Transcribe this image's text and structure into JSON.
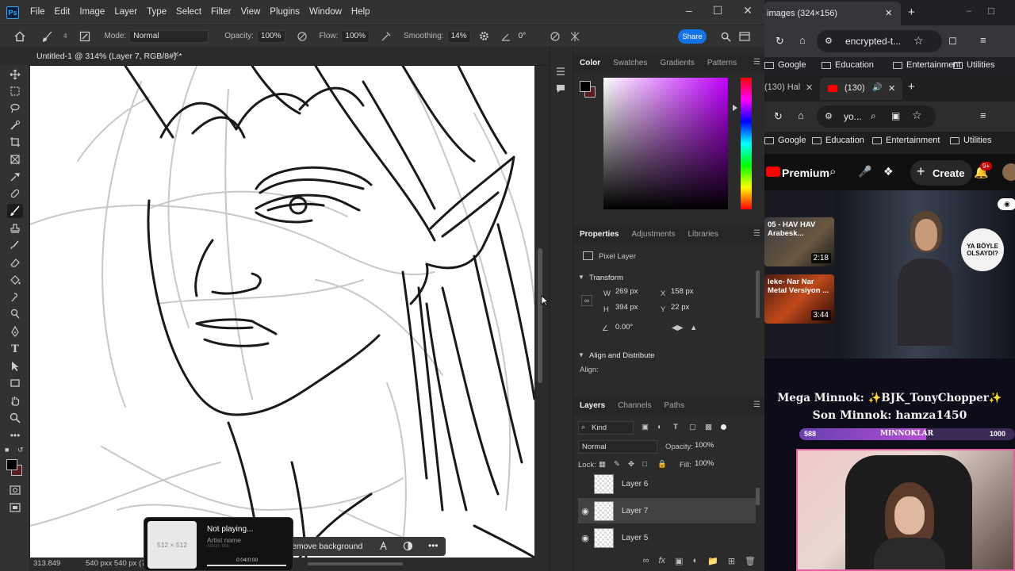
{
  "ps": {
    "logo": "Ps",
    "menu": [
      "File",
      "Edit",
      "Image",
      "Layer",
      "Type",
      "Select",
      "Filter",
      "View",
      "Plugins",
      "Window",
      "Help"
    ],
    "options": {
      "brush_size": "4",
      "mode_label": "Mode:",
      "mode_value": "Normal",
      "opacity_label": "Opacity:",
      "opacity_value": "100%",
      "flow_label": "Flow:",
      "flow_value": "100%",
      "smoothing_label": "Smoothing:",
      "smoothing_value": "14%",
      "angle_value": "0°",
      "share_label": "Share"
    },
    "document_tab": "Untitled-1 @ 314% (Layer 7, RGB/8#) *",
    "status": {
      "zoom": "313.849",
      "dims": "540 pxx 540 px (72 p"
    },
    "floatbar": {
      "label": "emove background"
    },
    "media": {
      "art_label": "512 × 512",
      "title": "Not playing...",
      "artist": "Artist name",
      "album": "Album title",
      "time": "0:04/0:00"
    },
    "color_panel": {
      "tabs": [
        "Color",
        "Swatches",
        "Gradients",
        "Patterns"
      ],
      "foreground": "#000000",
      "background": "#5a1e1e"
    },
    "properties": {
      "tabs": [
        "Properties",
        "Adjustments",
        "Libraries"
      ],
      "layer_type": "Pixel Layer",
      "transform_title": "Transform",
      "w_label": "W",
      "w_value": "269 px",
      "h_label": "H",
      "h_value": "394 px",
      "x_label": "X",
      "x_value": "158 px",
      "y_label": "Y",
      "y_value": "22 px",
      "angle": "0.00°",
      "align_title": "Align and Distribute",
      "align_label": "Align:"
    },
    "layers_panel": {
      "tabs": [
        "Layers",
        "Channels",
        "Paths"
      ],
      "filter_kind": "Kind",
      "blend_mode": "Normal",
      "opacity_label": "Opacity:",
      "opacity_value": "100%",
      "lock_label": "Lock:",
      "fill_label": "Fill:",
      "fill_value": "100%",
      "layers": [
        {
          "name": "Layer 6",
          "visible": false,
          "active": false
        },
        {
          "name": "Layer 7",
          "visible": true,
          "active": true
        },
        {
          "name": "Layer 5",
          "visible": true,
          "active": false
        }
      ]
    }
  },
  "browser": {
    "tab1_title": "images (324×156)",
    "url1": "encrypted-t...",
    "bookmarks": [
      "Google",
      "Education",
      "Entertainment",
      "Utilities"
    ],
    "tab2_title": "(130) Hal",
    "tab3_title": "(130)",
    "url2": "yo...",
    "yt": {
      "premium": "Premium",
      "create_label": "Create",
      "notif_count": "9+",
      "video1_title": "05 - HAV HAV Arabesk...",
      "video1_duration": "2:18",
      "video2_title": "leke- Nar Nar Metal Versiyon ...",
      "video2_duration": "3:44",
      "side_label_1": "YA BÖYLE",
      "side_label_2": "OLSAYDI?"
    },
    "stream": {
      "mega_line": "Mega Minnok: ✨BJK_TonyChopper✨",
      "son_line": "Son Minnok: hamza1450",
      "bar_left": "588",
      "bar_label": "MINNOKLAR",
      "bar_right": "1000",
      "bar_progress": 0.588
    }
  }
}
